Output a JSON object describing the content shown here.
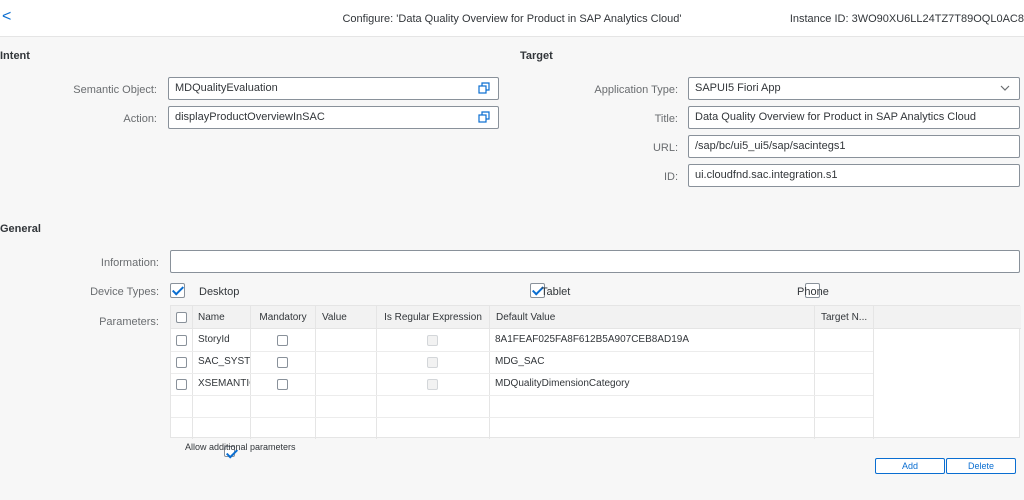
{
  "header": {
    "back_label": "<",
    "title": "Configure: 'Data Quality Overview for Product in SAP Analytics Cloud'",
    "instance": "Instance ID: 3WO90XU6LL24TZ7T89OQL0AC8"
  },
  "intent": {
    "section_title": "Intent",
    "semantic_object_label": "Semantic Object:",
    "semantic_object_value": "MDQualityEvaluation",
    "action_label": "Action:",
    "action_value": "displayProductOverviewInSAC"
  },
  "target": {
    "section_title": "Target",
    "app_type_label": "Application Type:",
    "app_type_value": "SAPUI5 Fiori App",
    "title_label": "Title:",
    "title_value": "Data Quality Overview for Product in SAP Analytics Cloud",
    "url_label": "URL:",
    "url_value": "/sap/bc/ui5_ui5/sap/sacintegs1",
    "id_label": "ID:",
    "id_value": "ui.cloudfnd.sac.integration.s1"
  },
  "general": {
    "section_title": "General",
    "information_label": "Information:",
    "information_value": "",
    "device_types_label": "Device Types:",
    "devices": [
      {
        "label": "Desktop",
        "checked": true
      },
      {
        "label": "Tablet",
        "checked": true
      },
      {
        "label": "Phone",
        "checked": false
      }
    ],
    "parameters_label": "Parameters:"
  },
  "parameters_table": {
    "columns": [
      "Name",
      "Mandatory",
      "Value",
      "Is Regular Expression",
      "Default Value",
      "Target N..."
    ],
    "rows": [
      {
        "name": "StoryId",
        "mandatory": false,
        "value": "",
        "is_regex": false,
        "default_value": "8A1FEAF025FA8F612B5A907CEB8AD19A",
        "target": ""
      },
      {
        "name": "SAC_SYSTE",
        "mandatory": false,
        "value": "",
        "is_regex": false,
        "default_value": "MDG_SAC",
        "target": ""
      },
      {
        "name": "XSEMANTIC",
        "mandatory": false,
        "value": "",
        "is_regex": false,
        "default_value": "MDQualityDimensionCategory",
        "target": ""
      }
    ]
  },
  "allow_additional": {
    "label": "Allow additional parameters",
    "checked": true
  },
  "buttons": {
    "add": "Add",
    "delete": "Delete"
  },
  "colors": {
    "accent": "#0a6ed1",
    "background": "#f7f7f7",
    "border": "#89919a"
  }
}
